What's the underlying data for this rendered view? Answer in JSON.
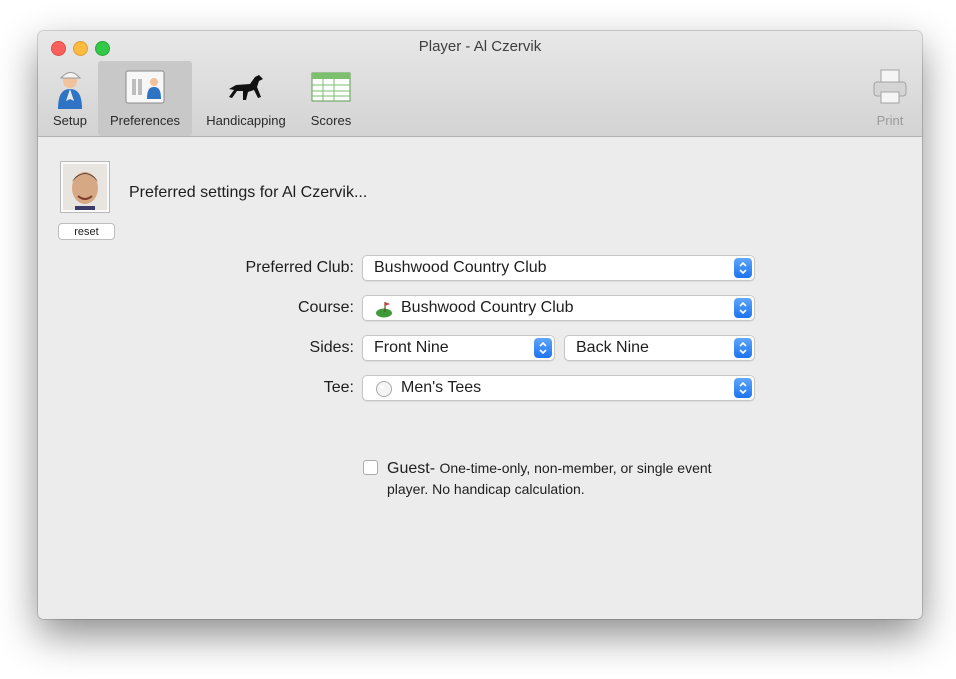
{
  "window": {
    "title": "Player - Al Czervik"
  },
  "toolbar": {
    "setup_label": "Setup",
    "preferences_label": "Preferences",
    "handicapping_label": "Handicapping",
    "scores_label": "Scores",
    "print_label": "Print",
    "selected": "Preferences"
  },
  "main": {
    "heading": "Preferred settings for Al Czervik...",
    "reset_label": "reset",
    "preferred_club": {
      "label": "Preferred Club:",
      "value": "Bushwood Country Club"
    },
    "course": {
      "label": "Course:",
      "value": "Bushwood Country Club"
    },
    "sides": {
      "label": "Sides:",
      "front_value": "Front Nine",
      "back_value": "Back Nine"
    },
    "tee": {
      "label": "Tee:",
      "value": "Men's Tees"
    },
    "guest": {
      "checked": false,
      "title": "Guest-",
      "description": "One-time-only, non-member, or single event player.  No handicap calculation."
    }
  },
  "colors": {
    "accent": "#1c74f0",
    "close": "#fc605c",
    "minimize": "#fdbc40",
    "maximize": "#34c84a"
  }
}
